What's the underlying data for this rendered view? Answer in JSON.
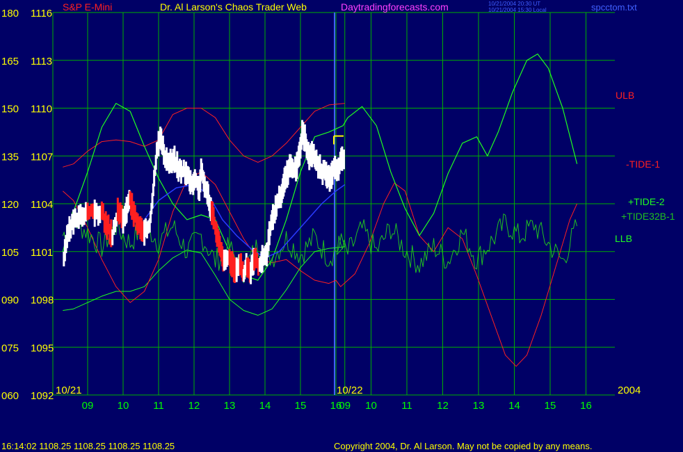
{
  "header": {
    "symbol": "S&P E-Mini",
    "title": "Dr. Al Larson's Chaos Trader Web",
    "site": "Daytradingforecasts.com",
    "utc_line": "10/21/2004 20:30 UT",
    "local_line": "10/21/2004 15:30 Local",
    "file": "spcctom.txt"
  },
  "footer": {
    "quote": "16:14:02  1108.25 1108.25 1108.25 1108.25",
    "copyright": "Copyright 2004, Dr. Al Larson. May not be copied by any means."
  },
  "colors": {
    "background": "#000066",
    "grid": "#00b000",
    "yellow_text": "#ffff00",
    "ulb_tide1": "#ff2020",
    "tide2_llb": "#20ff20",
    "tide32b": "#20c020",
    "price_up": "#ffffff",
    "price_down": "#ff2020",
    "average": "#2a3cff",
    "magenta": "#ff40ff",
    "session_divider": "#4060ff"
  },
  "chart_data": {
    "type": "line",
    "y_axis_left": [
      "180",
      "165",
      "150",
      "135",
      "120",
      "105",
      "090",
      "075",
      "060"
    ],
    "y_axis_price": [
      "1116",
      "1113",
      "1110",
      "1107",
      "1104",
      "1101",
      "1098",
      "1095",
      "1092"
    ],
    "ylim_price": [
      1092,
      1116
    ],
    "x_ticks": [
      "09",
      "10",
      "11",
      "12",
      "13",
      "14",
      "15",
      "16",
      "09",
      "10",
      "11",
      "12",
      "13",
      "14",
      "15",
      "16"
    ],
    "x_hours": [
      9,
      10,
      11,
      12,
      13,
      14,
      15,
      16,
      9,
      10,
      11,
      12,
      13,
      14,
      15,
      16
    ],
    "session_labels": [
      "10/21",
      "10/22"
    ],
    "year_label": "2004",
    "grid": true,
    "series_labels": {
      "ulb": "ULB",
      "tide1": "-TIDE-1",
      "tide2": "+TIDE-2",
      "tide32b": "+TIDE32B-1",
      "llb": "LLB"
    },
    "last_price_marker": 1108.25,
    "price_series": [
      [
        8.33,
        1100.5
      ],
      [
        8.45,
        1102.2
      ],
      [
        8.6,
        1102.8
      ],
      [
        8.8,
        1103.2
      ],
      [
        9.0,
        1103.6
      ],
      [
        9.2,
        1103.4
      ],
      [
        9.4,
        1103.5
      ],
      [
        9.55,
        1102.6
      ],
      [
        9.7,
        1102.0
      ],
      [
        9.85,
        1103.5
      ],
      [
        10.0,
        1103.0
      ],
      [
        10.1,
        1103.6
      ],
      [
        10.2,
        1104.3
      ],
      [
        10.3,
        1103.4
      ],
      [
        10.45,
        1102.6
      ],
      [
        10.6,
        1102.1
      ],
      [
        10.75,
        1102.6
      ],
      [
        10.85,
        1104.8
      ],
      [
        10.95,
        1107.4
      ],
      [
        11.05,
        1108.2
      ],
      [
        11.15,
        1107.1
      ],
      [
        11.3,
        1106.6
      ],
      [
        11.45,
        1106.8
      ],
      [
        11.6,
        1106.1
      ],
      [
        11.75,
        1106.0
      ],
      [
        11.85,
        1105.6
      ],
      [
        11.95,
        1105.3
      ],
      [
        12.05,
        1105.5
      ],
      [
        12.15,
        1105.0
      ],
      [
        12.2,
        1106.0
      ],
      [
        12.3,
        1105.2
      ],
      [
        12.4,
        1104.5
      ],
      [
        12.5,
        1103.5
      ],
      [
        12.55,
        1103.0
      ],
      [
        12.65,
        1102.0
      ],
      [
        12.75,
        1101.0
      ],
      [
        12.85,
        1100.3
      ],
      [
        13.0,
        1100.6
      ],
      [
        13.1,
        1100.0
      ],
      [
        13.2,
        1099.8
      ],
      [
        13.3,
        1100.4
      ],
      [
        13.4,
        1099.5
      ],
      [
        13.5,
        1100.2
      ],
      [
        13.6,
        1099.8
      ],
      [
        13.7,
        1100.5
      ],
      [
        13.85,
        1100.2
      ],
      [
        13.95,
        1100.7
      ],
      [
        14.05,
        1100.9
      ],
      [
        14.15,
        1102.4
      ],
      [
        14.25,
        1103.4
      ],
      [
        14.35,
        1104.1
      ],
      [
        14.45,
        1104.6
      ],
      [
        14.55,
        1105.5
      ],
      [
        14.65,
        1106.0
      ],
      [
        14.75,
        1106.5
      ],
      [
        14.85,
        1106.1
      ],
      [
        14.95,
        1106.8
      ],
      [
        15.05,
        1108.4
      ],
      [
        15.15,
        1108.0
      ],
      [
        15.25,
        1106.9
      ],
      [
        15.35,
        1107.2
      ],
      [
        15.45,
        1106.6
      ],
      [
        15.55,
        1106.3
      ],
      [
        15.65,
        1106.0
      ],
      [
        15.75,
        1105.7
      ],
      [
        15.85,
        1105.5
      ],
      [
        15.95,
        1106.3
      ],
      [
        16.05,
        1106.0
      ],
      [
        16.15,
        1106.7
      ],
      [
        16.25,
        1107.0
      ]
    ],
    "average_series": [
      [
        10.6,
        1103.0
      ],
      [
        11.0,
        1104.2
      ],
      [
        11.5,
        1105.0
      ],
      [
        12.0,
        1105.2
      ],
      [
        12.4,
        1104.6
      ],
      [
        12.8,
        1103.0
      ],
      [
        13.2,
        1102.0
      ],
      [
        13.6,
        1101.2
      ],
      [
        14.0,
        1100.6
      ],
      [
        14.4,
        1101.0
      ],
      [
        14.8,
        1102.0
      ],
      [
        15.2,
        1103.0
      ],
      [
        15.6,
        1104.0
      ],
      [
        16.0,
        1104.8
      ],
      [
        16.25,
        1105.2
      ]
    ],
    "ulb_series": [
      [
        8.3,
        1106.3
      ],
      [
        8.6,
        1106.5
      ],
      [
        9.0,
        1107.3
      ],
      [
        9.4,
        1107.9
      ],
      [
        9.8,
        1108.0
      ],
      [
        10.2,
        1107.9
      ],
      [
        10.6,
        1107.6
      ],
      [
        11.0,
        1108.0
      ],
      [
        11.4,
        1109.6
      ],
      [
        11.8,
        1110.0
      ],
      [
        12.2,
        1110.0
      ],
      [
        12.6,
        1109.4
      ],
      [
        13.0,
        1108.0
      ],
      [
        13.4,
        1107.0
      ],
      [
        13.8,
        1106.6
      ],
      [
        14.2,
        1107.0
      ],
      [
        14.6,
        1107.8
      ],
      [
        15.0,
        1108.8
      ],
      [
        15.4,
        1109.8
      ],
      [
        15.8,
        1110.2
      ],
      [
        16.25,
        1110.3
      ]
    ],
    "llb_series": [
      [
        8.3,
        1097.3
      ],
      [
        8.6,
        1097.4
      ],
      [
        9.0,
        1097.8
      ],
      [
        9.4,
        1098.2
      ],
      [
        9.8,
        1098.5
      ],
      [
        10.2,
        1098.5
      ],
      [
        10.6,
        1098.8
      ],
      [
        11.0,
        1099.8
      ],
      [
        11.4,
        1100.6
      ],
      [
        11.8,
        1101.1
      ],
      [
        12.2,
        1100.9
      ],
      [
        12.6,
        1099.5
      ],
      [
        13.0,
        1098.0
      ],
      [
        13.4,
        1097.3
      ],
      [
        13.8,
        1097.0
      ],
      [
        14.2,
        1097.4
      ],
      [
        14.6,
        1098.6
      ],
      [
        15.0,
        1100.0
      ],
      [
        15.4,
        1101.0
      ],
      [
        15.8,
        1101.2
      ],
      [
        16.25,
        1101.3
      ]
    ],
    "tide1_series": [
      [
        8.3,
        1104.8
      ],
      [
        8.6,
        1104.2
      ],
      [
        9.0,
        1102.5
      ],
      [
        9.4,
        1100.5
      ],
      [
        9.8,
        1098.8
      ],
      [
        10.2,
        1097.8
      ],
      [
        10.6,
        1098.5
      ],
      [
        11.0,
        1100.5
      ],
      [
        11.4,
        1103.5
      ],
      [
        11.8,
        1105.5
      ],
      [
        12.2,
        1106.0
      ],
      [
        12.6,
        1105.2
      ],
      [
        13.0,
        1103.5
      ],
      [
        13.4,
        1101.8
      ],
      [
        13.8,
        1100.5
      ],
      [
        14.2,
        1100.3
      ],
      [
        14.6,
        1100.5
      ],
      [
        15.0,
        1099.8
      ],
      [
        15.4,
        1099.2
      ],
      [
        15.8,
        1099.0
      ],
      [
        16.0,
        1099.2
      ],
      [
        16.4,
        1098.8
      ],
      [
        16.8,
        1099.6
      ],
      [
        17.2,
        1101.5
      ],
      [
        17.6,
        1104.0
      ],
      [
        17.9,
        1105.3
      ],
      [
        18.2,
        1104.8
      ],
      [
        18.6,
        1102.0
      ],
      [
        19.0,
        1101.0
      ],
      [
        19.4,
        1102.5
      ],
      [
        19.8,
        1101.8
      ],
      [
        20.2,
        1099.5
      ],
      [
        20.6,
        1097.0
      ],
      [
        21.0,
        1094.5
      ],
      [
        21.3,
        1093.8
      ],
      [
        21.6,
        1094.5
      ],
      [
        22.0,
        1097.0
      ],
      [
        22.4,
        1100.0
      ],
      [
        22.8,
        1103.0
      ],
      [
        23.0,
        1104.0
      ]
    ],
    "tide2_series": [
      [
        8.3,
        1101.0
      ],
      [
        8.6,
        1103.5
      ],
      [
        9.0,
        1106.0
      ],
      [
        9.4,
        1108.8
      ],
      [
        9.8,
        1110.3
      ],
      [
        10.2,
        1109.8
      ],
      [
        10.6,
        1107.6
      ],
      [
        11.0,
        1105.6
      ],
      [
        11.4,
        1104.0
      ],
      [
        11.8,
        1103.0
      ],
      [
        12.2,
        1103.3
      ],
      [
        12.6,
        1103.0
      ],
      [
        13.0,
        1101.0
      ],
      [
        13.4,
        1099.5
      ],
      [
        13.8,
        1099.2
      ],
      [
        14.2,
        1100.5
      ],
      [
        14.6,
        1103.0
      ],
      [
        15.0,
        1106.0
      ],
      [
        15.4,
        1108.2
      ],
      [
        15.8,
        1108.5
      ],
      [
        16.2,
        1108.9
      ],
      [
        16.6,
        1109.4
      ],
      [
        17.0,
        1110.1
      ],
      [
        17.4,
        1108.9
      ],
      [
        17.8,
        1106.0
      ],
      [
        18.2,
        1103.7
      ],
      [
        18.6,
        1102.0
      ],
      [
        19.0,
        1103.4
      ],
      [
        19.4,
        1105.9
      ],
      [
        19.8,
        1107.8
      ],
      [
        20.2,
        1108.2
      ],
      [
        20.5,
        1107.0
      ],
      [
        20.8,
        1108.5
      ],
      [
        21.2,
        1111.0
      ],
      [
        21.6,
        1113.0
      ],
      [
        21.9,
        1113.4
      ],
      [
        22.2,
        1112.5
      ],
      [
        22.6,
        1110.0
      ],
      [
        23.0,
        1106.5
      ]
    ],
    "tide32b_series": [
      [
        8.3,
        1102.0
      ],
      [
        8.6,
        1103.0
      ],
      [
        9.0,
        1102.2
      ],
      [
        9.4,
        1101.3
      ],
      [
        9.8,
        1102.6
      ],
      [
        10.2,
        1101.5
      ],
      [
        10.6,
        1102.8
      ],
      [
        11.0,
        1101.6
      ],
      [
        11.4,
        1102.6
      ],
      [
        11.8,
        1101.0
      ],
      [
        12.2,
        1102.0
      ],
      [
        12.6,
        1100.4
      ],
      [
        13.0,
        1101.2
      ],
      [
        13.4,
        1099.8
      ],
      [
        13.8,
        1101.4
      ],
      [
        14.2,
        1100.6
      ],
      [
        14.6,
        1101.8
      ],
      [
        15.0,
        1100.8
      ],
      [
        15.4,
        1101.9
      ],
      [
        15.8,
        1100.6
      ],
      [
        16.2,
        1101.6
      ],
      [
        16.6,
        1100.9
      ],
      [
        17.0,
        1102.4
      ],
      [
        17.4,
        1101.0
      ],
      [
        17.8,
        1102.5
      ],
      [
        18.2,
        1101.1
      ],
      [
        18.6,
        1100.2
      ],
      [
        19.0,
        1101.3
      ],
      [
        19.4,
        1100.4
      ],
      [
        19.8,
        1102.2
      ],
      [
        20.2,
        1100.5
      ],
      [
        20.6,
        1101.6
      ],
      [
        21.0,
        1102.8
      ],
      [
        21.4,
        1101.9
      ],
      [
        21.8,
        1102.7
      ],
      [
        22.2,
        1101.5
      ],
      [
        22.6,
        1100.4
      ],
      [
        23.0,
        1102.6
      ]
    ]
  }
}
